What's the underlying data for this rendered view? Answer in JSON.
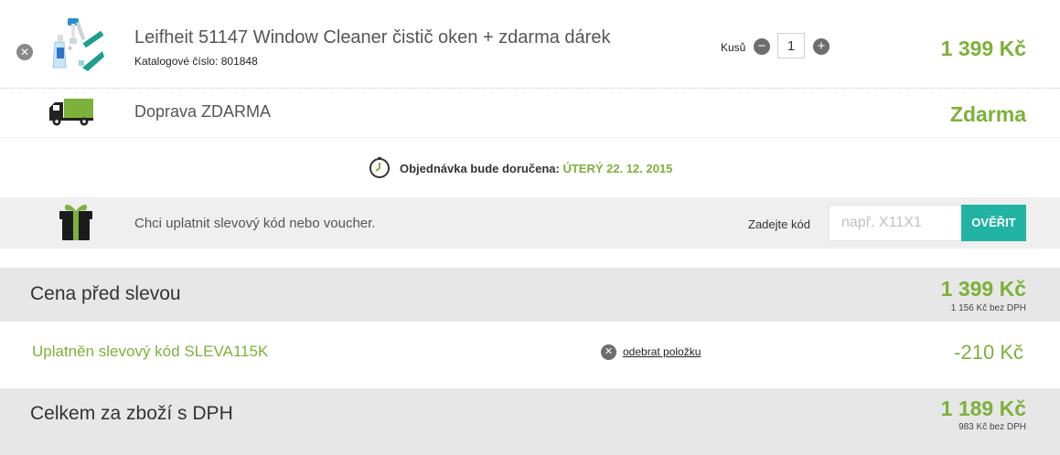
{
  "product": {
    "name": "Leifheit 51147 Window Cleaner čistič oken + zdarma dárek",
    "catalog_label": "Katalogové číslo:",
    "catalog_number": "801848",
    "qty_label": "Kusů",
    "qty_value": "1",
    "price": "1 399 Kč",
    "remove_icon": "close-icon",
    "minus_icon": "minus-icon",
    "plus_icon": "plus-icon"
  },
  "shipping": {
    "name": "Doprava ZDARMA",
    "price": "Zdarma",
    "icon": "truck-icon"
  },
  "delivery": {
    "label": "Objednávka bude doručena:",
    "date": "ÚTERÝ 22. 12. 2015",
    "icon": "clock-icon"
  },
  "voucher": {
    "text": "Chci uplatnit slevový kód nebo voucher.",
    "code_label": "Zadejte kód",
    "placeholder": "např. X11X1",
    "value": "",
    "verify_label": "OVĚŘIT",
    "icon": "gift-icon"
  },
  "summary": {
    "before_label": "Cena před slevou",
    "before_price": "1 399 Kč",
    "before_price_no_vat": "1 156 Kč bez DPH",
    "discount_label": "Uplatněn slevový kód SLEVA115K",
    "remove_link": "odebrat položku",
    "discount_value": "-210 Kč",
    "total_label": "Celkem za zboží s DPH",
    "total_price": "1 189 Kč",
    "total_price_no_vat": "983 Kč bez DPH"
  },
  "colors": {
    "accent_green": "#7cb13a",
    "button_teal": "#22b3a3",
    "band_gray": "#e7e7e7"
  }
}
